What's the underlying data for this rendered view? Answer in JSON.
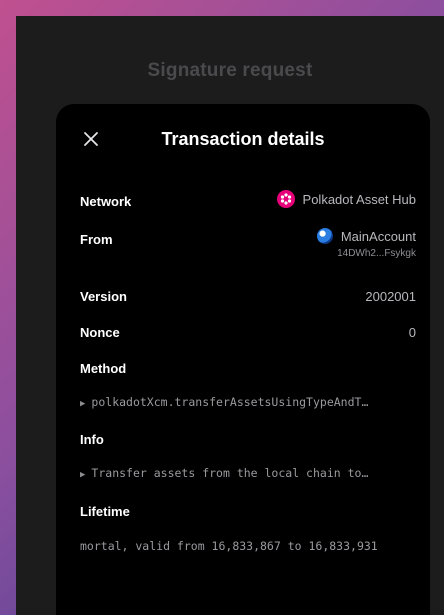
{
  "background_title": "Signature request",
  "sheet": {
    "title": "Transaction details",
    "close_icon": "close-icon"
  },
  "details": {
    "network": {
      "label": "Network",
      "value": "Polkadot Asset Hub",
      "icon": "polkadot-logo-icon"
    },
    "from": {
      "label": "From",
      "account_name": "MainAccount",
      "address": "14DWh2...Fsykgk",
      "icon": "account-avatar-icon"
    },
    "version": {
      "label": "Version",
      "value": "2002001"
    },
    "nonce": {
      "label": "Nonce",
      "value": "0"
    },
    "method": {
      "label": "Method",
      "value": "polkadotXcm.transferAssetsUsingTypeAndT…"
    },
    "info": {
      "label": "Info",
      "value": "Transfer assets from the local chain to…"
    },
    "lifetime": {
      "label": "Lifetime",
      "value": "mortal, valid from 16,833,867 to 16,833,931"
    }
  },
  "colors": {
    "accent_polkadot": "#e6007a",
    "sheet_bg": "#000000",
    "frame_bg": "#1c1c1d"
  }
}
